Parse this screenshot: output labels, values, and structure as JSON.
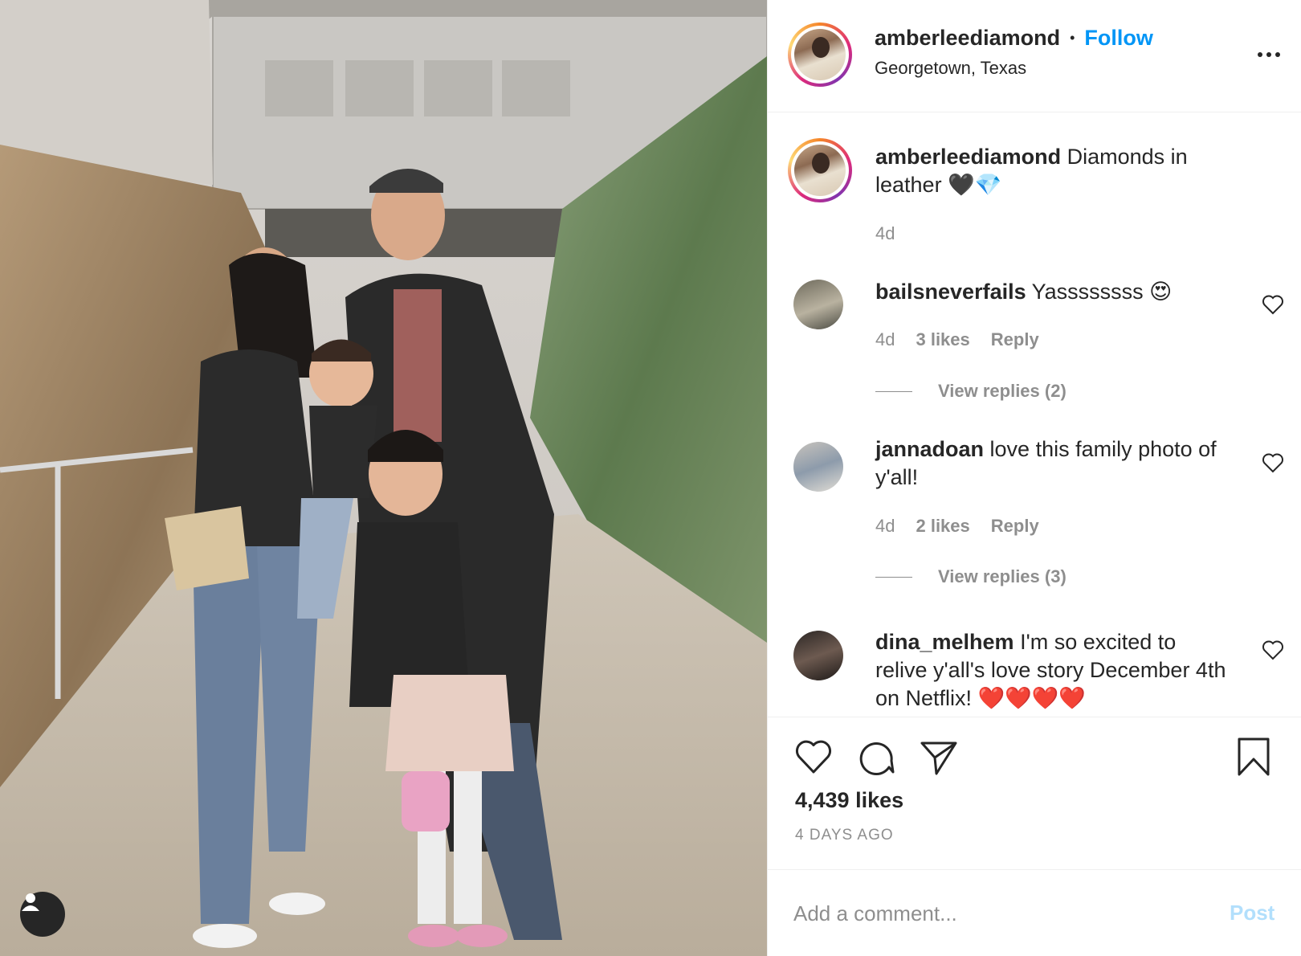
{
  "colors": {
    "accent": "#0095f6",
    "muted": "#8e8e8e",
    "text": "#262626",
    "post_disabled": "#b2dffc",
    "border": "#efefef"
  },
  "header": {
    "username": "amberleediamond",
    "separator": "•",
    "follow_label": "Follow",
    "location": "Georgetown, Texas",
    "more_icon": "more-options-icon"
  },
  "caption": {
    "username": "amberleediamond",
    "text": "Diamonds in leather 🖤💎",
    "time": "4d"
  },
  "comments": [
    {
      "username": "bailsneverfails",
      "text": "Yassssssss 😍",
      "time": "4d",
      "likes": "3 likes",
      "reply_label": "Reply",
      "view_replies": "View replies (2)"
    },
    {
      "username": "jannadoan",
      "text": "love this family photo of y'all!",
      "time": "4d",
      "likes": "2 likes",
      "reply_label": "Reply",
      "view_replies": "View replies (3)"
    },
    {
      "username": "dina_melhem",
      "text": "I'm so excited to relive y'all's love story December 4th on Netflix! ❤️❤️❤️❤️"
    }
  ],
  "actions": {
    "like_icon": "heart-icon",
    "comment_icon": "comment-bubble-icon",
    "share_icon": "send-paper-plane-icon",
    "save_icon": "bookmark-icon",
    "likes_text": "4,439 likes",
    "time_ago": "4 DAYS AGO"
  },
  "add_comment": {
    "placeholder": "Add a comment...",
    "post_label": "Post"
  },
  "photo": {
    "tag_icon": "user-tag-icon"
  }
}
